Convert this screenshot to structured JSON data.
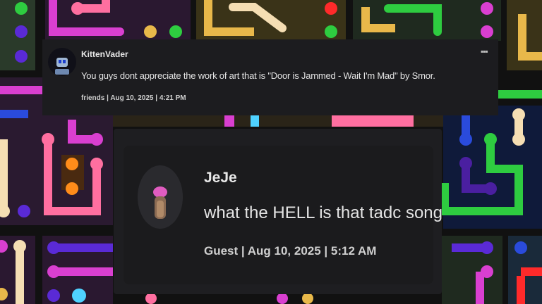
{
  "comments": [
    {
      "username": "KittenVader",
      "text": "You guys dont appreciate the work of art that is \"Door is Jammed - Wait I'm Mad\" by Smor.",
      "meta": "friends | Aug 10, 2025 | 4:21 PM",
      "menu_icon": "more-dots-icon"
    },
    {
      "username": "JeJe",
      "text": "what the HELL is that tadc song",
      "meta": "Guest | Aug 10, 2025 | 5:12 AM"
    }
  ],
  "background": {
    "description_colors": [
      "#e23bd0",
      "#2ecc40",
      "#e8b84a",
      "#ff6fa0",
      "#2a4bdc",
      "#f5deb3",
      "#ff2a2a",
      "#7a1fd6",
      "#ff8c1a"
    ]
  }
}
